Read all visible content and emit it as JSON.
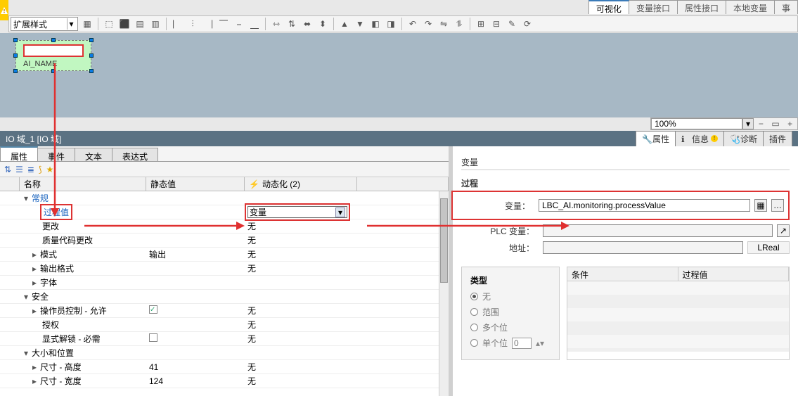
{
  "topTabs": {
    "t1": "可视化",
    "t2": "变量接口",
    "t3": "属性接口",
    "t4": "本地变量",
    "t5": "事"
  },
  "styleSelect": "扩展样式",
  "ioObject": {
    "label": "AI_NAME"
  },
  "zoom": "100%",
  "titleBar": "IO 域_1 [IO 域]",
  "titleTabs": {
    "props": "属性",
    "info": "信息",
    "diag": "诊断",
    "plugin": "插件"
  },
  "subTabs": {
    "t1": "属性",
    "t2": "事件",
    "t3": "文本",
    "t4": "表达式"
  },
  "gridHeader": {
    "name": "名称",
    "static": "静态值",
    "dyn": "动态化 (2)"
  },
  "tree": {
    "general": "常规",
    "procValue": "过程值",
    "change": "更改",
    "qcChange": "质量代码更改",
    "mode": "模式",
    "modeVal": "输出",
    "outFmt": "输出格式",
    "font": "字体",
    "security": "安全",
    "opCtrl": "操作员控制 - 允许",
    "auth": "授权",
    "unlock": "显式解锁 - 必需",
    "sizePos": "大小和位置",
    "szH": "尺寸 - 高度",
    "szHVal": "41",
    "szW": "尺寸 - 宽度",
    "szWVal": "124",
    "dynNone": "无",
    "dynVar": "变量"
  },
  "right": {
    "varLabel": "变量",
    "procLabel": "过程",
    "tagLabel": "变量：",
    "tagValue": "LBC_AI.monitoring.processValue",
    "plcLabel": "PLC 变量：",
    "addrLabel": "地址：",
    "addrType": "LReal",
    "typeLabel": "类型",
    "rNone": "无",
    "rRange": "范围",
    "rBits": "多个位",
    "rBit": "单个位",
    "bitVal": "0",
    "condCol": "条件",
    "procCol": "过程值"
  }
}
